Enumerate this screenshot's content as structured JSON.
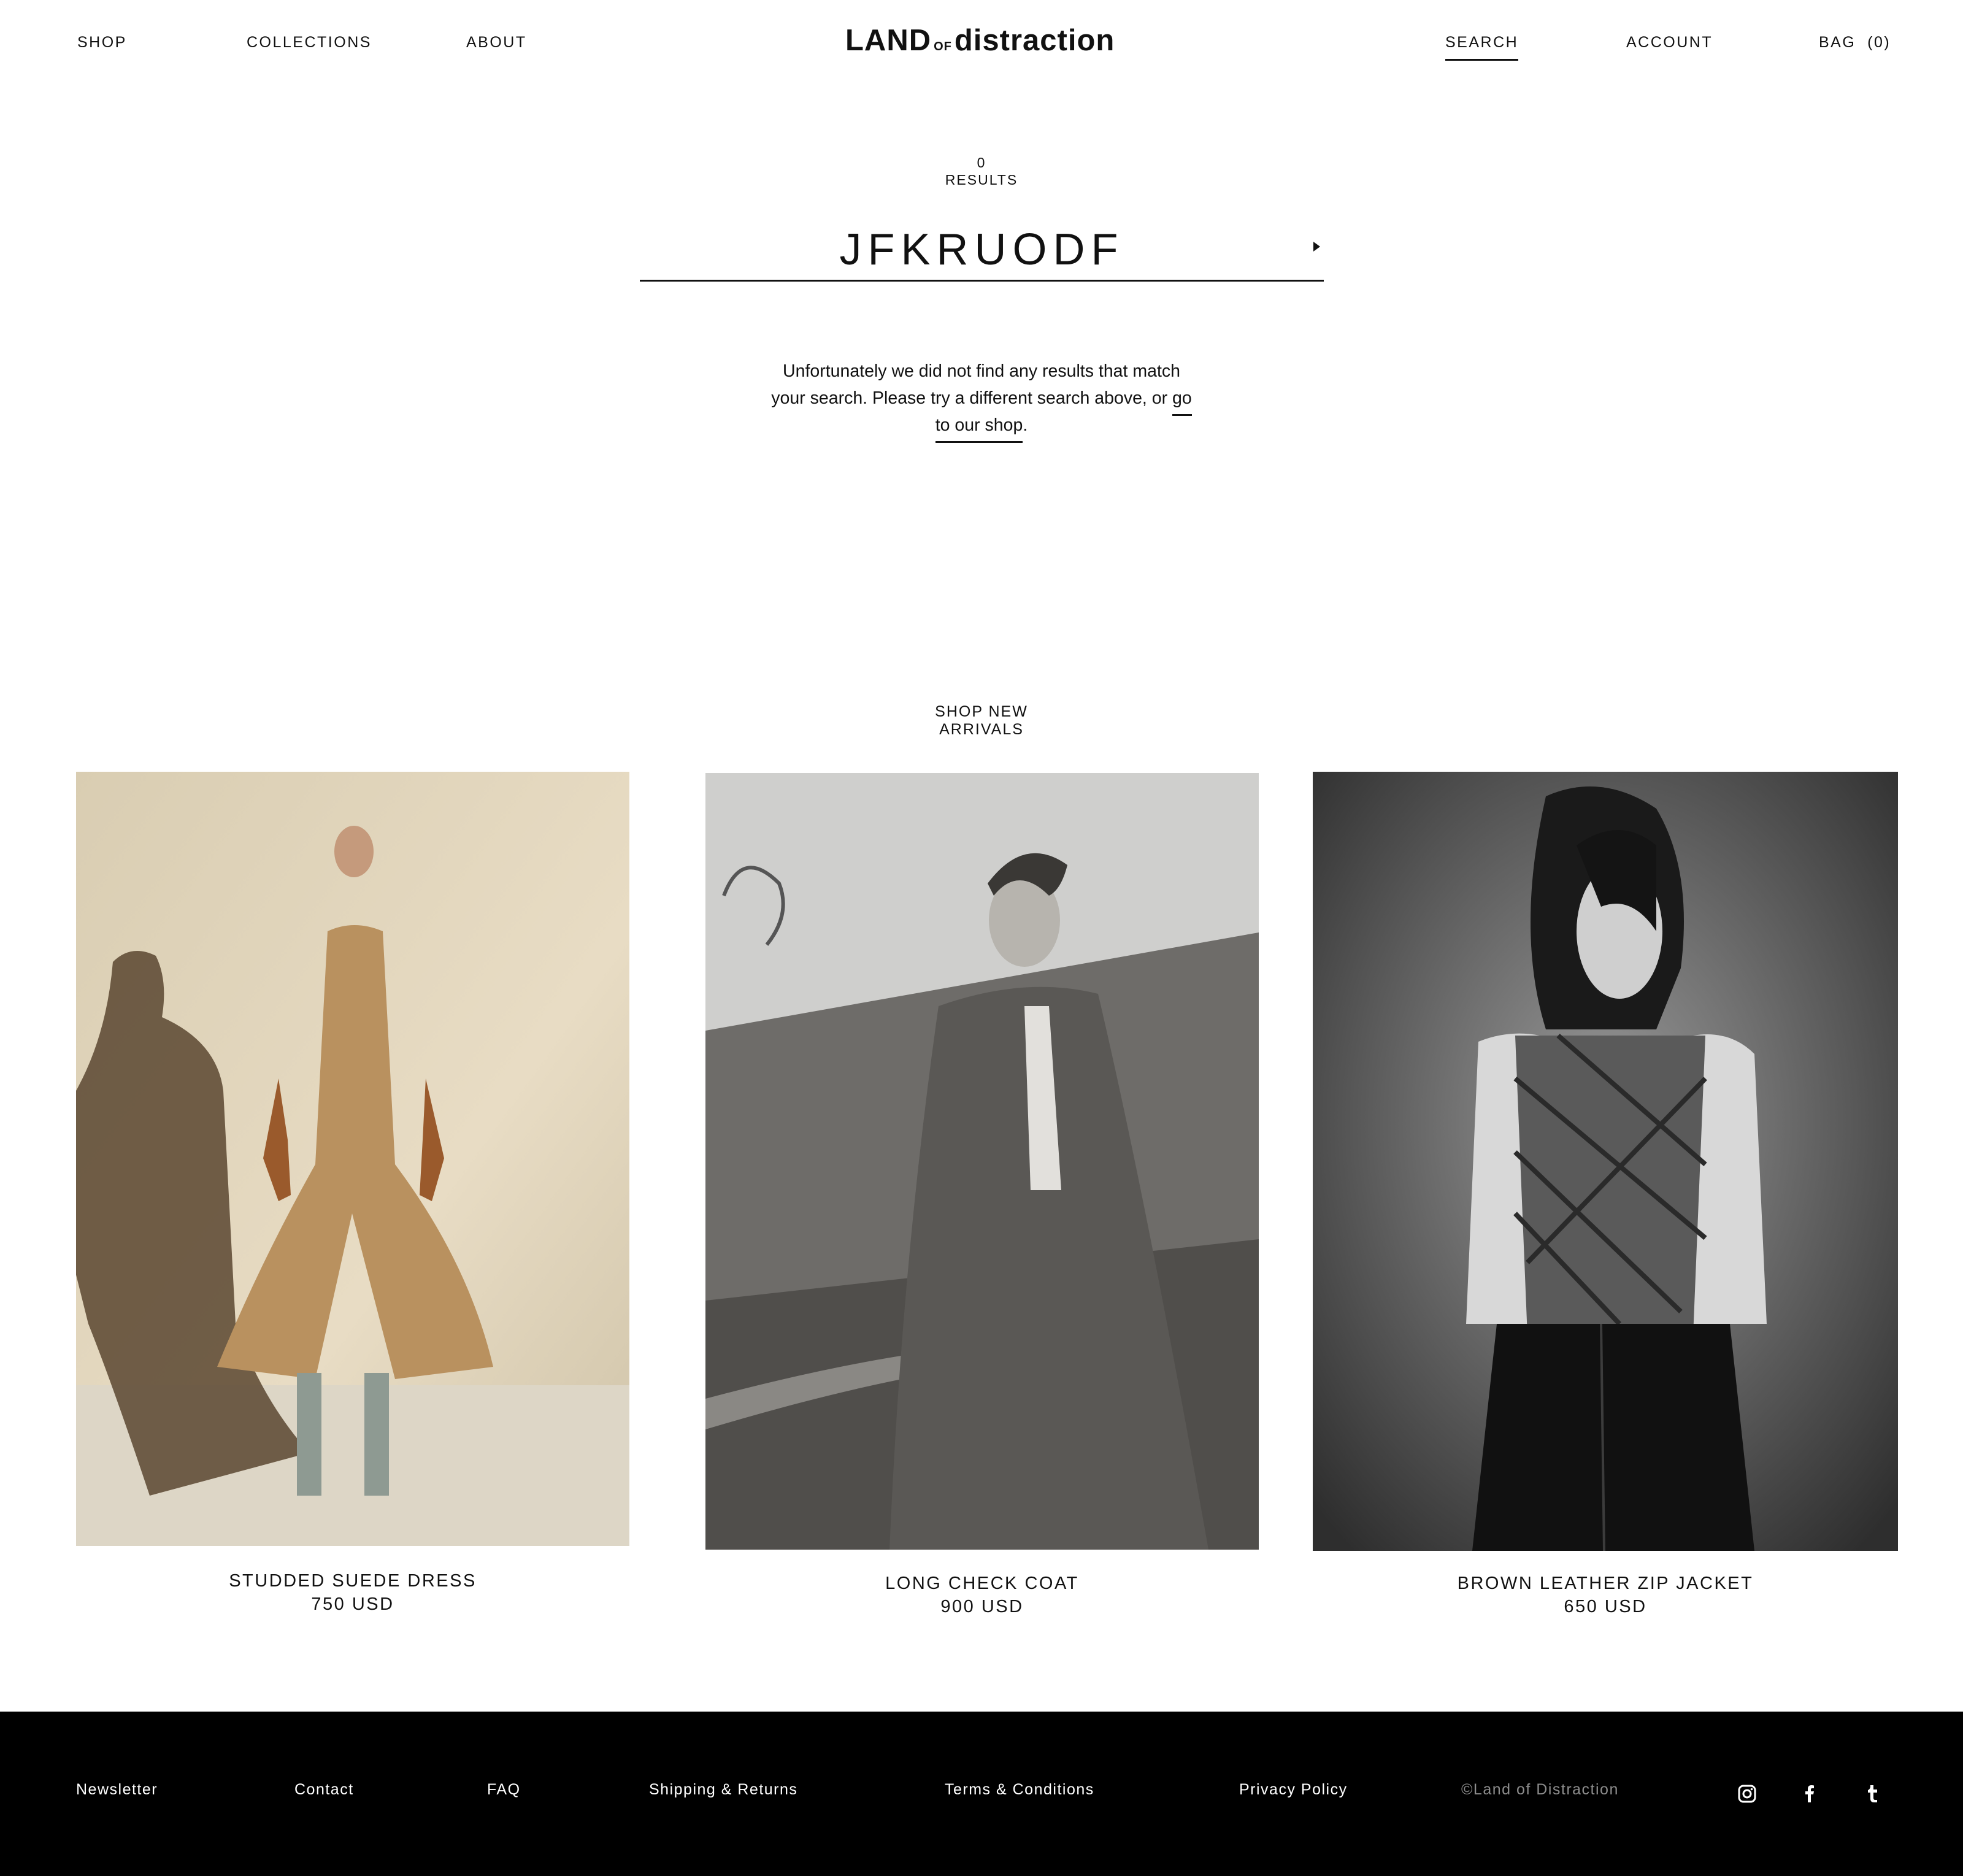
{
  "header": {
    "nav_left": [
      "SHOP",
      "COLLECTIONS",
      "ABOUT"
    ],
    "logo": {
      "land": "LAND",
      "of": "OF",
      "distraction": "distraction"
    },
    "nav_right": {
      "search": "SEARCH",
      "account": "ACCOUNT",
      "bag": "BAG  (0)"
    }
  },
  "search": {
    "count": "0",
    "count_label": "RESULTS",
    "query": "JFKRUODF",
    "message_prefix": "Unfortunately we did not find any results that match your search. Please try a different search above, or ",
    "shop_link": "go to our shop",
    "message_suffix": "."
  },
  "new_arrivals": {
    "title_line1": "SHOP NEW",
    "title_line2": "ARRIVALS",
    "products": [
      {
        "name": "STUDDED SUEDE DRESS",
        "price": "750 USD"
      },
      {
        "name": "LONG CHECK COAT",
        "price": "900 USD"
      },
      {
        "name": "BROWN LEATHER ZIP JACKET",
        "price": "650 USD"
      }
    ]
  },
  "footer": {
    "links": [
      "Newsletter",
      "Contact",
      "FAQ",
      "Shipping & Returns",
      "Terms & Conditions",
      "Privacy Policy"
    ],
    "copyright": "©Land of Distraction",
    "social_icons": [
      "instagram-icon",
      "facebook-icon",
      "tumblr-icon"
    ]
  },
  "colors": {
    "text": "#111111",
    "background": "#ffffff",
    "footer_bg": "#000000",
    "footer_text": "#ffffff",
    "copyright": "#8c8c8c"
  }
}
